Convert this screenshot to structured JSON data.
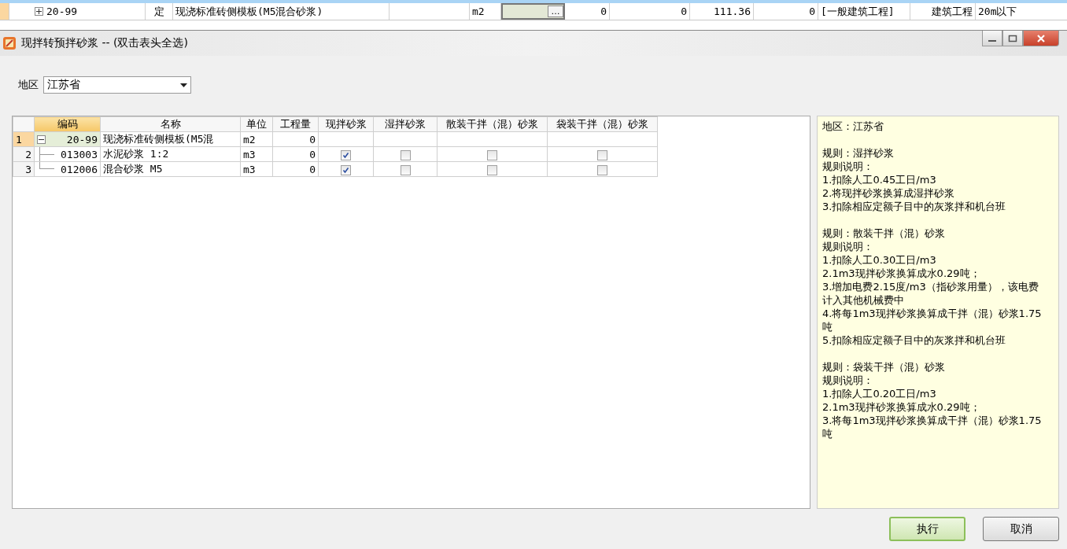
{
  "background_row": {
    "expanded": false,
    "code": "20-99",
    "type": "定",
    "name": "现浇标准砖侧模板(M5混合砂浆)",
    "unit": "m2",
    "column_6": "…",
    "values": [
      "0",
      "0",
      "111.36",
      "0"
    ],
    "category": "[一般建筑工程]",
    "specialty": "建筑工程",
    "height": "20m以下"
  },
  "window": {
    "title": "现拌转预拌砂浆 -- (双击表头全选)"
  },
  "region": {
    "label": "地区",
    "value": "江苏省"
  },
  "table": {
    "columns": [
      "编码",
      "名称",
      "单位",
      "工程量",
      "现拌砂浆",
      "湿拌砂浆",
      "散装干拌（混）砂浆",
      "袋装干拌（混）砂浆"
    ],
    "rows": [
      {
        "number": "1",
        "code": "20-99",
        "name": "现浇标准砖侧模板(M5混",
        "unit": "m2",
        "quantity": "0",
        "selected": true,
        "expanded": true,
        "checks": [],
        "children": [
          {
            "number": "2",
            "code": "013003",
            "name": "水泥砂浆 1:2",
            "unit": "m3",
            "quantity": "0",
            "selected": false,
            "checks": [
              {
                "checked": true
              },
              {
                "checked": false
              },
              {
                "checked": false
              },
              {
                "checked": false
              }
            ]
          },
          {
            "number": "3",
            "code": "012006",
            "name": "混合砂浆 M5",
            "unit": "m3",
            "quantity": "0",
            "selected": false,
            "checks": [
              {
                "checked": true
              },
              {
                "checked": false
              },
              {
                "checked": false
              },
              {
                "checked": false
              }
            ]
          }
        ]
      }
    ]
  },
  "notes": {
    "region_line": "地区：江苏省",
    "rules": [
      {
        "title": "规则：湿拌砂浆",
        "subtitle": "规则说明：",
        "items": [
          "1.扣除人工0.45工日/m3",
          "2.将现拌砂浆换算成湿拌砂浆",
          "3.扣除相应定额子目中的灰浆拌和机台班"
        ]
      },
      {
        "title": "规则：散装干拌（混）砂浆",
        "subtitle": "规则说明：",
        "items": [
          "1.扣除人工0.30工日/m3",
          "2.1m3现拌砂浆换算成水0.29吨；",
          "3.增加电费2.15度/m3（指砂浆用量），该电费计入其他机械费中",
          "4.将每1m3现拌砂浆换算成干拌（混）砂浆1.75吨",
          "5.扣除相应定额子目中的灰浆拌和机台班"
        ]
      },
      {
        "title": "规则：袋装干拌（混）砂浆",
        "subtitle": "规则说明：",
        "items": [
          "1.扣除人工0.20工日/m3",
          "2.1m3现拌砂浆换算成水0.29吨；",
          "3.将每1m3现拌砂浆换算成干拌（混）砂浆1.75吨"
        ]
      }
    ]
  },
  "buttons": [
    {
      "label": "执行",
      "kind": "primary"
    },
    {
      "label": "取消",
      "kind": "normal"
    }
  ]
}
